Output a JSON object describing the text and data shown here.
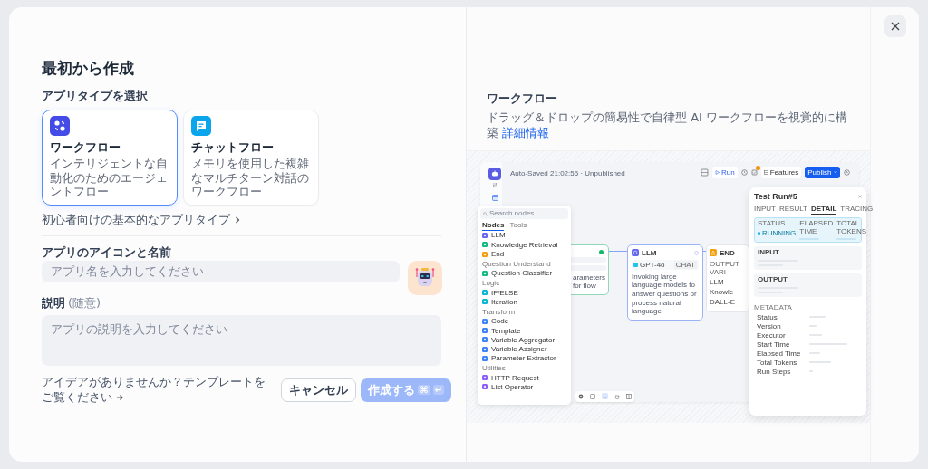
{
  "form": {
    "title": "最初から作成",
    "app_type_label": "アプリタイプを選択",
    "app_types": [
      {
        "kind": "workflow",
        "name": "ワークフロー",
        "description": "インテリジェントな自動化のためのエージェントフロー",
        "selected": true
      },
      {
        "kind": "chatflow",
        "name": "チャットフロー",
        "description": "メモリを使用した複雑なマルチターン対話のワークフロー",
        "selected": false
      }
    ],
    "beginner_link": "初心者向けの基本的なアプリタイプ",
    "name_label": "アプリのアイコンと名前",
    "name_placeholder": "アプリ名を入力してください",
    "description_label": "説明",
    "description_hint": "(随意)",
    "description_placeholder": "アプリの説明を入力してください",
    "template_link": "アイデアがありませんか？テンプレートをご覧ください",
    "buttons": [
      {
        "kind": "cancel",
        "label": "キャンセル",
        "disabled": false
      },
      {
        "kind": "create",
        "label": "作成する",
        "disabled": true,
        "keys": [
          "⌘",
          "↵"
        ]
      }
    ]
  },
  "preview": {
    "title": "ワークフロー",
    "description": "ドラッグ＆ドロップの簡易性で自律型 AI ワークフローを視覚的に構築",
    "link": "詳細情報",
    "app": {
      "autosave": "Auto-Saved 21:02:55 · Unpublished",
      "toolbar": {
        "run": "Run",
        "features": "Features",
        "publish": "Publish"
      },
      "node_panel": {
        "search_placeholder": "Search nodes...",
        "tabs": [
          {
            "label": "Nodes",
            "selected": true
          },
          {
            "label": "Tools",
            "selected": false
          }
        ],
        "groups": [
          {
            "items": [
              {
                "label": "LLM",
                "color": "#6366f1"
              },
              {
                "label": "Knowledge Retrieval",
                "color": "#10b981"
              },
              {
                "label": "End",
                "color": "#f59e0b"
              }
            ]
          },
          {
            "heading": "Question Understand",
            "items": [
              {
                "label": "Question Classifier",
                "color": "#10b981"
              }
            ]
          },
          {
            "heading": "Logic",
            "items": [
              {
                "label": "IF/ELSE",
                "color": "#06b6d4"
              },
              {
                "label": "Iteration",
                "color": "#06b6d4"
              }
            ]
          },
          {
            "heading": "Transform",
            "items": [
              {
                "label": "Code",
                "color": "#3b82f6"
              },
              {
                "label": "Template",
                "color": "#3b82f6"
              },
              {
                "label": "Variable Aggregator",
                "color": "#3b82f6"
              },
              {
                "label": "Variable Assigner",
                "color": "#3b82f6"
              },
              {
                "label": "Parameter Extractor",
                "color": "#3b82f6"
              }
            ]
          },
          {
            "heading": "Utilities",
            "items": [
              {
                "label": "HTTP Request",
                "color": "#8b5cf6"
              },
              {
                "label": "List Operator",
                "color": "#8b5cf6"
              }
            ]
          }
        ]
      },
      "nodes": [
        {
          "kind": "start",
          "description": "arameters for flow"
        },
        {
          "kind": "llm",
          "title": "LLM",
          "model": "GPT-4o",
          "tag": "CHAT",
          "description": "Invoking large language models to answer questions or process natural language"
        },
        {
          "kind": "end",
          "title": "END",
          "label": "OUTPUT VARI",
          "outputs": [
            "LLM",
            "Knowle",
            "DALL-E"
          ]
        }
      ],
      "test_run": {
        "title": "Test Run#5",
        "tabs": [
          {
            "label": "INPUT",
            "selected": false
          },
          {
            "label": "RESULT",
            "selected": false
          },
          {
            "label": "DETAIL",
            "selected": true
          },
          {
            "label": "TRACING",
            "selected": false
          }
        ],
        "status": {
          "label": "STATUS",
          "value": "RUNNING",
          "columns": [
            "ELAPSED TIME",
            "TOTAL TOKENS"
          ]
        },
        "sections": [
          "INPUT",
          "OUTPUT"
        ],
        "metadata_title": "METADATA",
        "metadata": [
          "Status",
          "Version",
          "Executor",
          "Start Time",
          "Elapsed Time",
          "Total Tokens",
          "Run Steps"
        ]
      }
    }
  }
}
